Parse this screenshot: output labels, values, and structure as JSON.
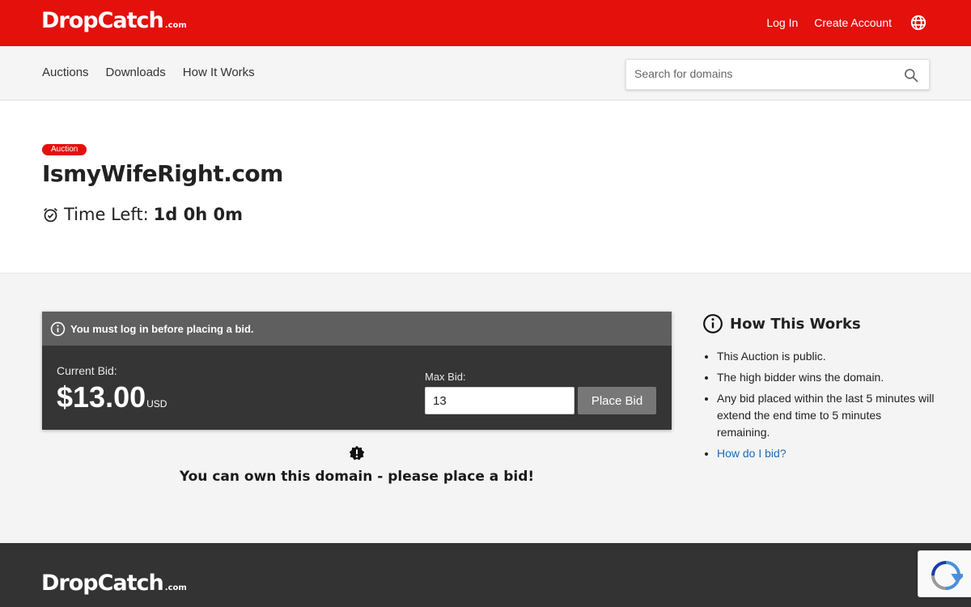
{
  "brand": {
    "logo_main": "DropCatch",
    "logo_suffix": ".com",
    "accent_color": "#e3100c"
  },
  "header": {
    "login": "Log In",
    "create_account": "Create Account",
    "language_icon": "globe-icon"
  },
  "nav": {
    "items": [
      "Auctions",
      "Downloads",
      "How It Works"
    ],
    "search_placeholder": "Search for domains",
    "search_icon": "search-icon"
  },
  "auction": {
    "badge": "Auction",
    "domain": "IsmyWifeRight.com",
    "time_left_label": "Time Left:",
    "time_left_value": "1d 0h 0m"
  },
  "bid": {
    "alert": "You must log in before placing a bid.",
    "current_label": "Current Bid:",
    "current_amount": "$13.00",
    "currency": "USD",
    "max_label": "Max Bid:",
    "max_value": "13",
    "place_bid": "Place Bid",
    "own_message": "You can own this domain - please place a bid!"
  },
  "how_it_works": {
    "title": "How This Works",
    "items": [
      "This Auction is public.",
      "The high bidder wins the domain.",
      "Any bid placed within the last 5 minutes will extend the end time to 5 minutes remaining."
    ],
    "link": "How do I bid?"
  }
}
